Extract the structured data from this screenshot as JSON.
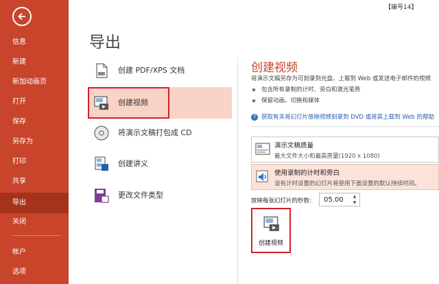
{
  "badge": "【编号14】",
  "nav": {
    "items": [
      {
        "label": "信息"
      },
      {
        "label": "新建"
      },
      {
        "label": "新加动画页"
      },
      {
        "label": "打开"
      },
      {
        "label": "保存"
      },
      {
        "label": "另存为"
      },
      {
        "label": "打印"
      },
      {
        "label": "共享"
      },
      {
        "label": "导出",
        "active": true
      },
      {
        "label": "关闭"
      },
      {
        "label": "帐户"
      },
      {
        "label": "选项"
      }
    ]
  },
  "page_title": "导出",
  "export_options": [
    {
      "label": "创建 PDF/XPS 文档",
      "icon": "pdf-document-icon"
    },
    {
      "label": "创建视频",
      "icon": "video-icon",
      "selected": true
    },
    {
      "label": "将演示文稿打包成 CD",
      "icon": "cd-icon"
    },
    {
      "label": "创建讲义",
      "icon": "handout-icon"
    },
    {
      "label": "更改文件类型",
      "icon": "change-file-type-icon"
    }
  ],
  "detail": {
    "title": "创建视频",
    "description": "将演示文稿另存为可刻录到光盘、上载到 Web 或发送电子邮件的视频",
    "bullets": [
      "包含所有录制的计时、旁白和激光笔势",
      "保留动画、切换和媒体"
    ],
    "link": "获取有关将幻灯片放映视频刻录到 DVD 或将其上载到 Web 的帮助",
    "quality": {
      "title": "演示文稿质量",
      "subtitle": "最大文件大小和最高质量(1920 x 1080)"
    },
    "narration": {
      "title": "使用录制的计时和旁白",
      "subtitle": "没有计时设置的幻灯片将使用下面设置的默认持续时间。"
    },
    "seconds_label": "放映每张幻灯片的秒数:",
    "seconds_value": "05.00",
    "create_button": "创建视频"
  },
  "colors": {
    "accent": "#c8442a",
    "nav_active": "#a5331c",
    "highlight": "#d0202a",
    "selected": "#f9d3c6",
    "link": "#2a5fa8"
  }
}
